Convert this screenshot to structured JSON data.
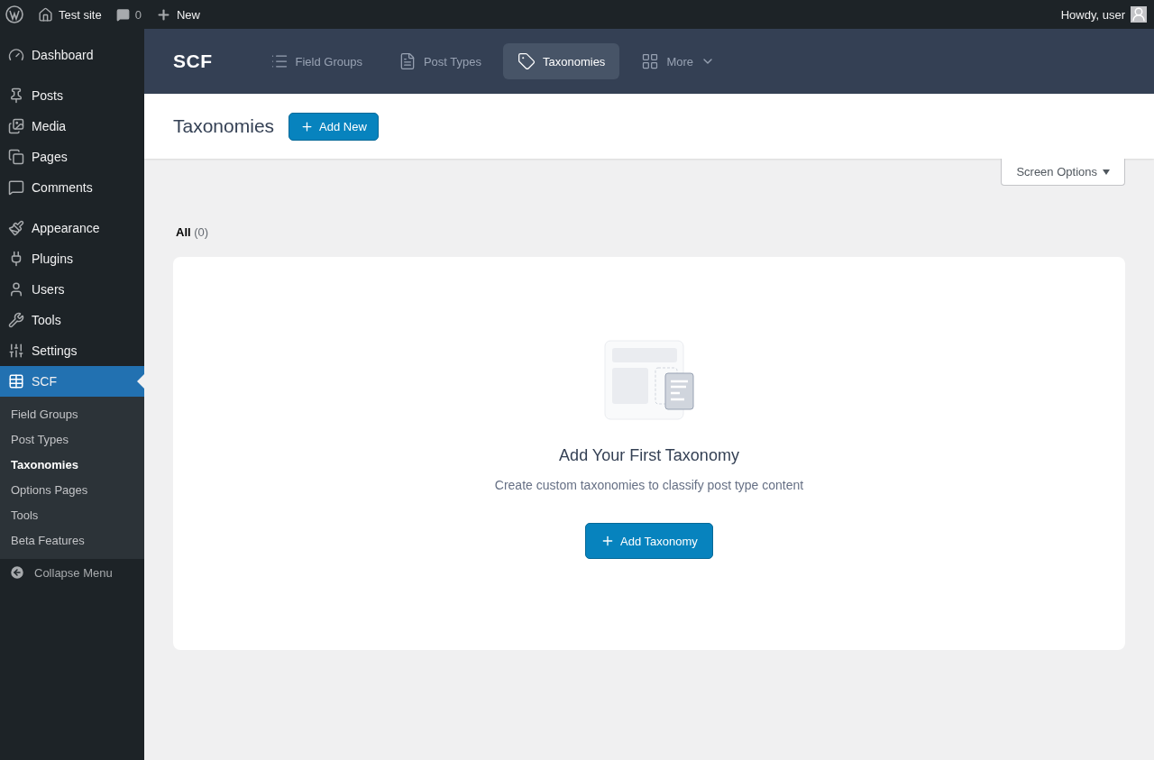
{
  "admin_bar": {
    "site": "Test site",
    "comments": "0",
    "new": "New",
    "greeting": "Howdy, user"
  },
  "sidebar": {
    "groups": [
      [
        {
          "label": "Dashboard",
          "selected": false
        }
      ],
      [
        {
          "label": "Posts",
          "selected": false
        },
        {
          "label": "Media",
          "selected": false
        },
        {
          "label": "Pages",
          "selected": false
        },
        {
          "label": "Comments",
          "selected": false
        }
      ],
      [
        {
          "label": "Appearance",
          "selected": false
        },
        {
          "label": "Plugins",
          "selected": false
        },
        {
          "label": "Users",
          "selected": false
        },
        {
          "label": "Tools",
          "selected": false
        },
        {
          "label": "Settings",
          "selected": false
        },
        {
          "label": "SCF",
          "selected": true
        }
      ]
    ],
    "submenu": [
      {
        "label": "Field Groups",
        "selected": false
      },
      {
        "label": "Post Types",
        "selected": false
      },
      {
        "label": "Taxonomies",
        "selected": true
      },
      {
        "label": "Options Pages",
        "selected": false
      },
      {
        "label": "Tools",
        "selected": false
      },
      {
        "label": "Beta Features",
        "selected": false
      }
    ],
    "collapse": "Collapse Menu"
  },
  "plugin_nav": {
    "logo": "SCF",
    "tabs": [
      {
        "label": "Field Groups",
        "selected": false
      },
      {
        "label": "Post Types",
        "selected": false
      },
      {
        "label": "Taxonomies",
        "selected": true
      },
      {
        "label": "More",
        "selected": false
      }
    ]
  },
  "page": {
    "title": "Taxonomies",
    "add_button": "Add New",
    "screen_options": "Screen Options",
    "filter": {
      "label": "All",
      "count": "(0)"
    }
  },
  "empty_state": {
    "heading": "Add Your First Taxonomy",
    "description": "Create custom taxonomies to classify post type content",
    "button": "Add Taxonomy"
  }
}
